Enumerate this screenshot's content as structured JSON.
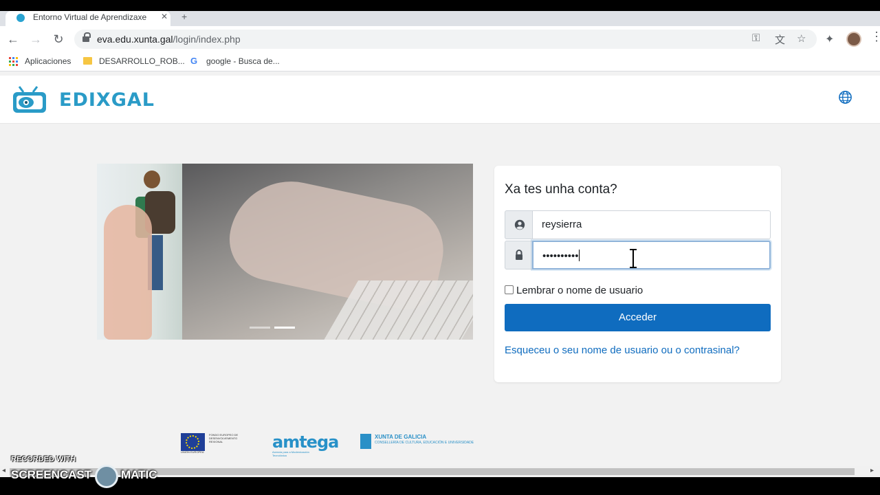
{
  "browser": {
    "tab_title": "Entorno Virtual de Aprendizaxe",
    "tab_close": "✕",
    "new_tab": "+",
    "url_host": "eva.edu.xunta.gal",
    "url_path": "/login/index.php",
    "icons": {
      "back": "←",
      "forward": "→",
      "reload": "↻",
      "key": "⚿",
      "translate": "文",
      "star": "☆",
      "extensions": "✦",
      "menu": "⋮"
    },
    "bookmarks": [
      "Aplicaciones",
      "DESARROLLO_ROB...",
      "google - Busca de..."
    ]
  },
  "site": {
    "logo_text": "EDIXGAL",
    "accent": "#2a9bc7"
  },
  "login": {
    "title": "Xa tes unha conta?",
    "username_value": "reysierra",
    "password_value": "••••••••••",
    "remember_label": "Lembrar o nome de usuario",
    "remember_checked": false,
    "submit_label": "Acceder",
    "forgot_link": "Esqueceu o seu nome de usuario ou o contrasinal?",
    "button_color": "#0f6cbf"
  },
  "footer": {
    "eu_text": "FONDO EUROPEO DE DESENVOLVEMENTO REXIONAL",
    "eu_sub": "UNIÓN EUROPEA",
    "amtega": "amtega",
    "amtega_sub": "Axencia para a Modernización Tecnolóxica",
    "xunta": "XUNTA DE GALICIA",
    "xunta_sub": "CONSELLERÍA DE CULTURA, EDUCACIÓN E UNIVERSIDADE"
  },
  "watermark": {
    "line1": "RECORDED WITH",
    "line2": "SCREENCAST",
    "line3": "MATIC"
  }
}
